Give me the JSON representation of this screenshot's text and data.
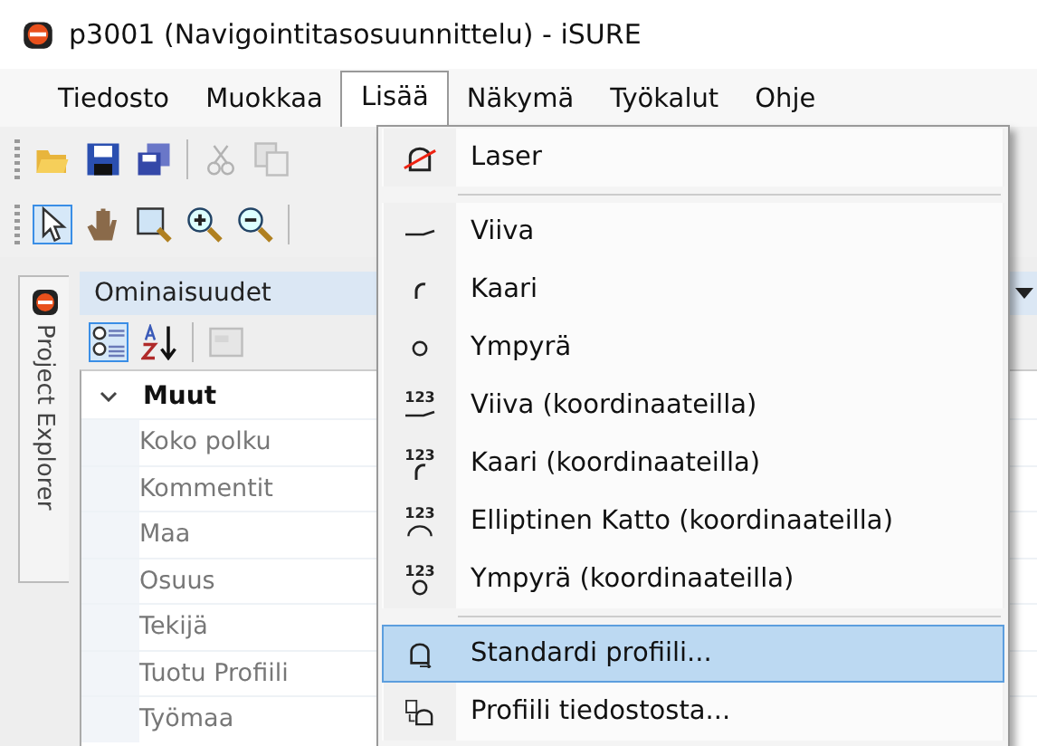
{
  "window": {
    "title": "p3001 (Navigointitasosuunnittelu) - iSURE"
  },
  "menubar": [
    {
      "label": "Tiedosto",
      "selected": false
    },
    {
      "label": "Muokkaa",
      "selected": false
    },
    {
      "label": "Lisää",
      "selected": true
    },
    {
      "label": "Näkymä",
      "selected": false
    },
    {
      "label": "Työkalut",
      "selected": false
    },
    {
      "label": "Ohje",
      "selected": false
    }
  ],
  "side_tab": {
    "label": "Project Explorer"
  },
  "properties": {
    "title": "Ominaisuudet",
    "category": {
      "label": "Muut",
      "expanded": true
    },
    "rows": [
      "Koko polku",
      "Kommentit",
      "Maa",
      "Osuus",
      "Tekijä",
      "Tuotu Profiili",
      "Työmaa"
    ]
  },
  "menu": [
    {
      "kind": "laser",
      "label": "Laser",
      "selected": false
    },
    {
      "kind": "separator"
    },
    {
      "kind": "line",
      "label": "Viiva",
      "selected": false
    },
    {
      "kind": "arc",
      "label": "Kaari",
      "selected": false
    },
    {
      "kind": "circle",
      "label": "Ympyrä",
      "selected": false
    },
    {
      "kind": "line",
      "badge": "123",
      "label": "Viiva (koordinaateilla)",
      "selected": false
    },
    {
      "kind": "arc",
      "badge": "123",
      "label": "Kaari (koordinaateilla)",
      "selected": false
    },
    {
      "kind": "ellipse",
      "badge": "123",
      "label": "Elliptinen Katto (koordinaateilla)",
      "selected": false
    },
    {
      "kind": "circle",
      "badge": "123",
      "label": "Ympyrä (koordinaateilla)",
      "selected": false
    },
    {
      "kind": "separator"
    },
    {
      "kind": "profile",
      "label": "Standardi profiili...",
      "selected": true
    },
    {
      "kind": "fileprofile",
      "label": "Profiili tiedostosta...",
      "selected": false
    }
  ]
}
